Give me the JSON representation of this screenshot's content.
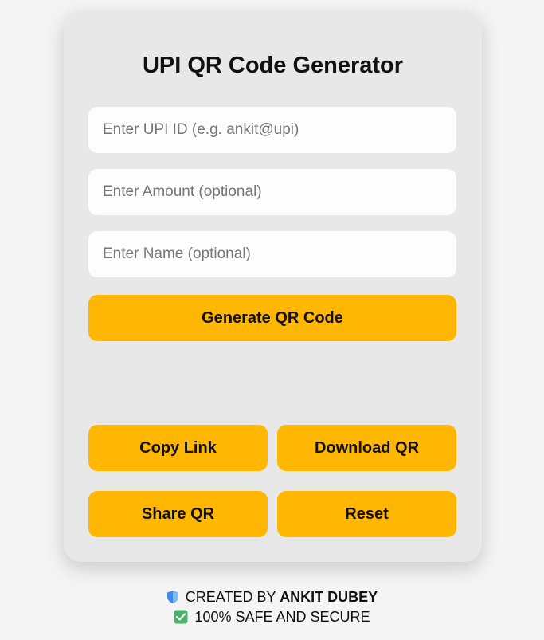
{
  "title": "UPI QR Code Generator",
  "form": {
    "upi_placeholder": "Enter UPI ID (e.g. ankit@upi)",
    "amount_placeholder": "Enter Amount (optional)",
    "name_placeholder": "Enter Name (optional)"
  },
  "buttons": {
    "generate": "Generate QR Code",
    "copy": "Copy Link",
    "download": "Download QR",
    "share": "Share QR",
    "reset": "Reset"
  },
  "footer": {
    "created_prefix": "CREATED BY",
    "author": "ANKIT DUBEY",
    "safe_text": "100% SAFE AND SECURE",
    "shield_icon": "shield-icon",
    "check_icon": "check-box-icon"
  },
  "colors": {
    "accent": "#ffb703",
    "card": "#e8e8e8",
    "background": "#f4f4f4"
  }
}
